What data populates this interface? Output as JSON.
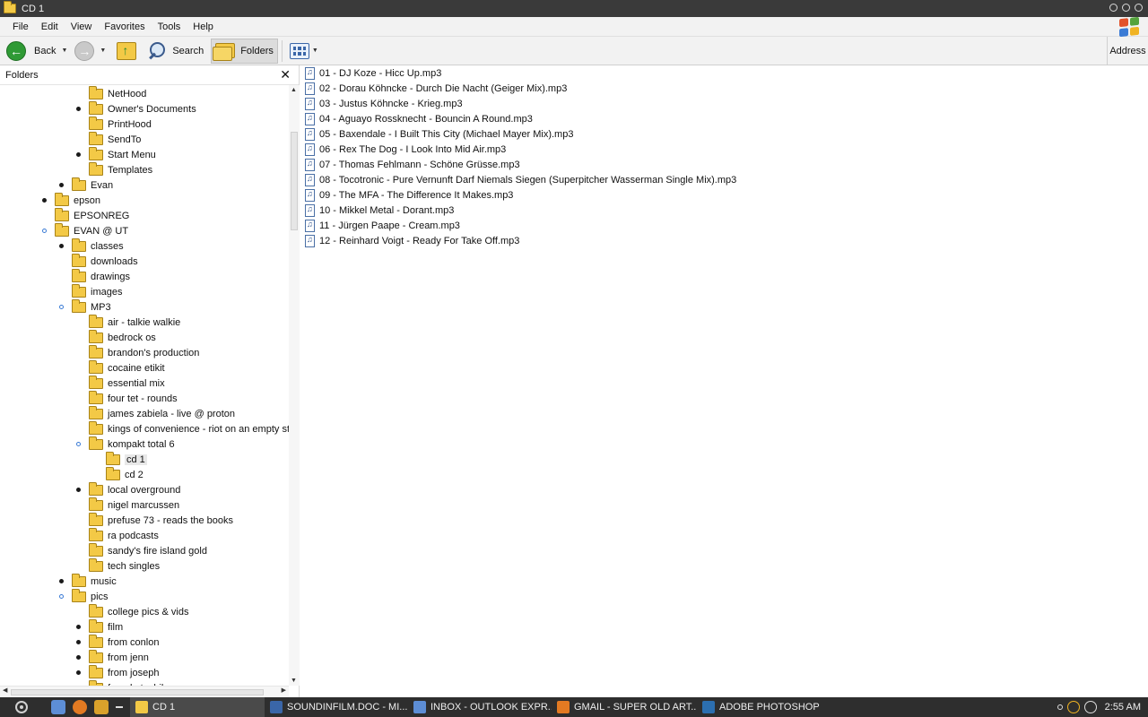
{
  "window": {
    "title": "CD 1"
  },
  "menu": [
    "File",
    "Edit",
    "View",
    "Favorites",
    "Tools",
    "Help"
  ],
  "toolbar": {
    "back_label": "Back",
    "search_label": "Search",
    "folders_label": "Folders",
    "address_label": "Address"
  },
  "folders_pane": {
    "title": "Folders",
    "close_glyph": "✕"
  },
  "tree": [
    {
      "label": "NetHood",
      "bullet": "",
      "icon": "folder-icon"
    },
    {
      "label": "Owner's Documents",
      "bullet": "filled",
      "icon": "folder-icon"
    },
    {
      "label": "PrintHood",
      "bullet": "",
      "icon": "folder-icon"
    },
    {
      "label": "SendTo",
      "bullet": "",
      "icon": "folder-icon"
    },
    {
      "label": "Start Menu",
      "bullet": "filled",
      "icon": "folder-icon"
    },
    {
      "label": "Templates",
      "bullet": "",
      "icon": "folder-icon"
    },
    {
      "label": "Evan",
      "bullet": "filled",
      "icon": "folder-icon"
    },
    {
      "label": "epson",
      "bullet": "filled",
      "icon": "folder-icon"
    },
    {
      "label": "EPSONREG",
      "bullet": "",
      "icon": "folder-icon"
    },
    {
      "label": "EVAN @ UT",
      "bullet": "open",
      "icon": "folder-icon"
    },
    {
      "label": "classes",
      "bullet": "filled",
      "icon": "folder-icon"
    },
    {
      "label": "downloads",
      "bullet": "",
      "icon": "folder-icon"
    },
    {
      "label": "drawings",
      "bullet": "",
      "icon": "folder-icon"
    },
    {
      "label": "images",
      "bullet": "",
      "icon": "folder-icon"
    },
    {
      "label": "MP3",
      "bullet": "open",
      "icon": "folder-icon"
    },
    {
      "label": "air - talkie walkie",
      "bullet": "",
      "icon": "folder-icon"
    },
    {
      "label": "bedrock os",
      "bullet": "",
      "icon": "folder-icon"
    },
    {
      "label": "brandon's production",
      "bullet": "",
      "icon": "folder-icon"
    },
    {
      "label": "cocaine etikit",
      "bullet": "",
      "icon": "folder-icon"
    },
    {
      "label": "essential mix",
      "bullet": "",
      "icon": "folder-icon"
    },
    {
      "label": "four tet - rounds",
      "bullet": "",
      "icon": "folder-icon"
    },
    {
      "label": "james zabiela - live @ proton",
      "bullet": "",
      "icon": "folder-icon"
    },
    {
      "label": "kings of convenience - riot on an empty stre",
      "bullet": "",
      "icon": "folder-icon"
    },
    {
      "label": "kompakt total 6",
      "bullet": "open",
      "icon": "folder-icon"
    },
    {
      "label": "cd 1",
      "bullet": "",
      "icon": "folder-icon",
      "selected": true
    },
    {
      "label": "cd 2",
      "bullet": "",
      "icon": "folder-icon"
    },
    {
      "label": "local overground",
      "bullet": "filled",
      "icon": "folder-icon"
    },
    {
      "label": "nigel marcussen",
      "bullet": "",
      "icon": "folder-icon"
    },
    {
      "label": "prefuse 73 - reads the books",
      "bullet": "",
      "icon": "folder-icon"
    },
    {
      "label": "ra podcasts",
      "bullet": "",
      "icon": "folder-icon"
    },
    {
      "label": "sandy's fire island gold",
      "bullet": "",
      "icon": "folder-icon"
    },
    {
      "label": "tech singles",
      "bullet": "",
      "icon": "folder-icon"
    },
    {
      "label": "music",
      "bullet": "filled",
      "icon": "folder-icon"
    },
    {
      "label": "pics",
      "bullet": "open",
      "icon": "folder-icon"
    },
    {
      "label": "college pics & vids",
      "bullet": "",
      "icon": "folder-icon"
    },
    {
      "label": "film",
      "bullet": "filled",
      "icon": "folder-icon"
    },
    {
      "label": "from conlon",
      "bullet": "filled",
      "icon": "folder-icon"
    },
    {
      "label": "from jenn",
      "bullet": "filled",
      "icon": "folder-icon"
    },
    {
      "label": "from joseph",
      "bullet": "filled",
      "icon": "folder-icon"
    },
    {
      "label": "from le toshiba",
      "bullet": "filled",
      "icon": "folder-icon"
    }
  ],
  "files": [
    "01 - DJ Koze - Hicc Up.mp3",
    "02 - Dorau Köhncke - Durch Die Nacht (Geiger Mix).mp3",
    "03 - Justus Köhncke - Krieg.mp3",
    "04 - Aguayo Rossknecht - Bouncin A Round.mp3",
    "05 - Baxendale - I Built This City (Michael Mayer Mix).mp3",
    "06 - Rex The Dog - I Look Into Mid Air.mp3",
    "07 - Thomas Fehlmann - Schöne Grüsse.mp3",
    "08 - Tocotronic - Pure Vernunft Darf Niemals Siegen (Superpitcher Wasserman Single Mix).mp3",
    "09 - The MFA - The Difference It Makes.mp3",
    "10 - Mikkel Metal - Dorant.mp3",
    "11 - Jürgen Paape - Cream.mp3",
    "12 - Reinhard Voigt - Ready For Take Off.mp3"
  ],
  "taskbar": {
    "tasks": [
      {
        "label": "CD 1",
        "icon": "folder-icon",
        "color": "#f3c946",
        "active": true
      },
      {
        "label": "SOUNDINFILM.DOC - MI...",
        "icon": "word-icon",
        "color": "#3a66a8",
        "active": false
      },
      {
        "label": "INBOX - OUTLOOK EXPR...",
        "icon": "outlook-icon",
        "color": "#5d8ed6",
        "active": false
      },
      {
        "label": "GMAIL - SUPER OLD ART...",
        "icon": "firefox-icon",
        "color": "#e37a22",
        "active": false
      },
      {
        "label": "ADOBE PHOTOSHOP",
        "icon": "photoshop-icon",
        "color": "#2c6fb0",
        "active": false
      }
    ],
    "clock": "2:55 AM"
  },
  "colors": {
    "accent": "#3a7bd5",
    "folder": "#f3c946",
    "taskbar": "#2e2e2e"
  }
}
